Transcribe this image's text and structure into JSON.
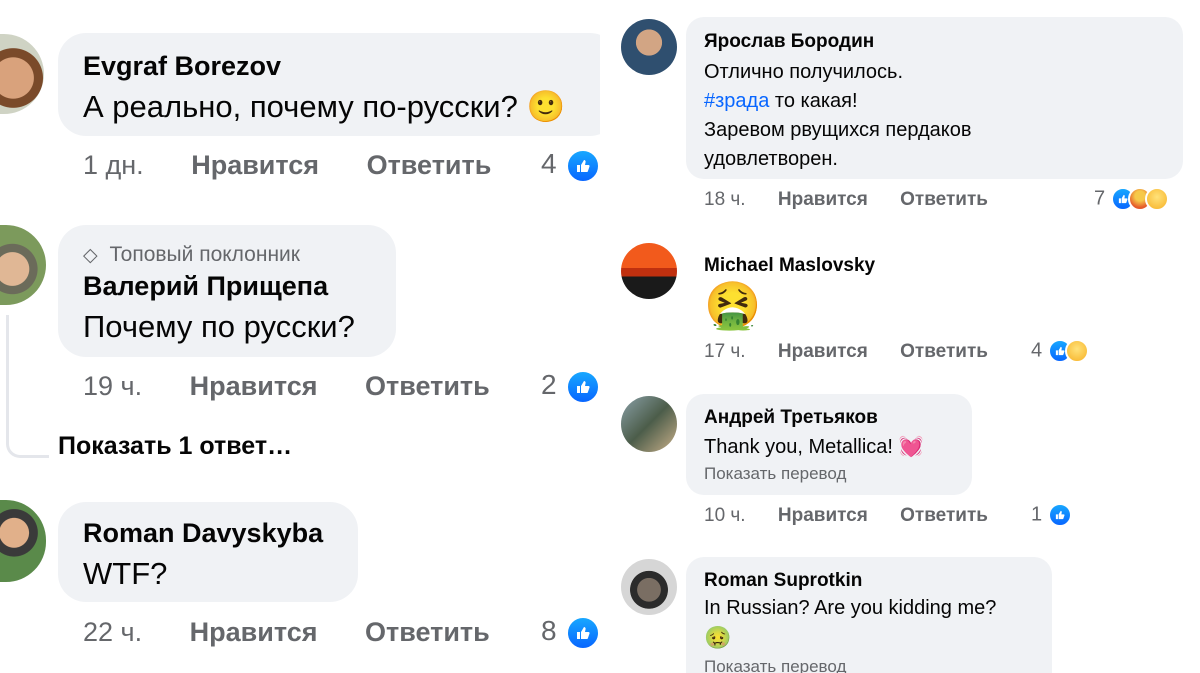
{
  "left_comments": [
    {
      "author": "Evgraf Borezov",
      "text": "А реально, почему по-русски? 🙂",
      "time": "1 дн.",
      "like_label": "Нравится",
      "reply_label": "Ответить",
      "reaction_count": "4"
    },
    {
      "badge": "Топовый поклонник",
      "author": "Валерий Прищепа",
      "text": "Почему по русски?",
      "time": "19 ч.",
      "like_label": "Нравится",
      "reply_label": "Ответить",
      "reaction_count": "2",
      "show_replies": "Показать 1 ответ…"
    },
    {
      "author": "Roman Davyskyba",
      "text": "WTF?",
      "time": "22 ч.",
      "like_label": "Нравится",
      "reply_label": "Ответить",
      "reaction_count": "8"
    }
  ],
  "right_comments": [
    {
      "author": "Ярослав Бородин",
      "line1": "Отлично получилось.",
      "hashtag": "#зрада",
      "line2_rest": " то какая!",
      "line3": "Заревом рвущихся пердаков",
      "line4": "удовлетворен.",
      "time": "18 ч.",
      "like_label": "Нравится",
      "reply_label": "Ответить",
      "reaction_count": "7",
      "reactions": [
        "like-icon",
        "angry-icon",
        "haha-icon"
      ]
    },
    {
      "author": "Michael Maslovsky",
      "emoji": "🤮",
      "time": "17 ч.",
      "like_label": "Нравится",
      "reply_label": "Ответить",
      "reaction_count": "4",
      "reactions": [
        "like-icon",
        "haha-icon"
      ]
    },
    {
      "author": "Андрей Третьяков",
      "text": "Thank you, Metallica! 💓",
      "translate": "Показать перевод",
      "time": "10 ч.",
      "like_label": "Нравится",
      "reply_label": "Ответить",
      "reaction_count": "1",
      "reactions": [
        "like-icon"
      ]
    },
    {
      "author": "Roman Suprotkin",
      "text": "In Russian? Are you kidding me?",
      "emoji": "🤢",
      "translate": "Показать перевод"
    }
  ],
  "colors": {
    "bubble": "#f0f2f5",
    "meta_text": "#65676b",
    "like_blue": "#0866ff",
    "hashtag": "#0866ff"
  }
}
